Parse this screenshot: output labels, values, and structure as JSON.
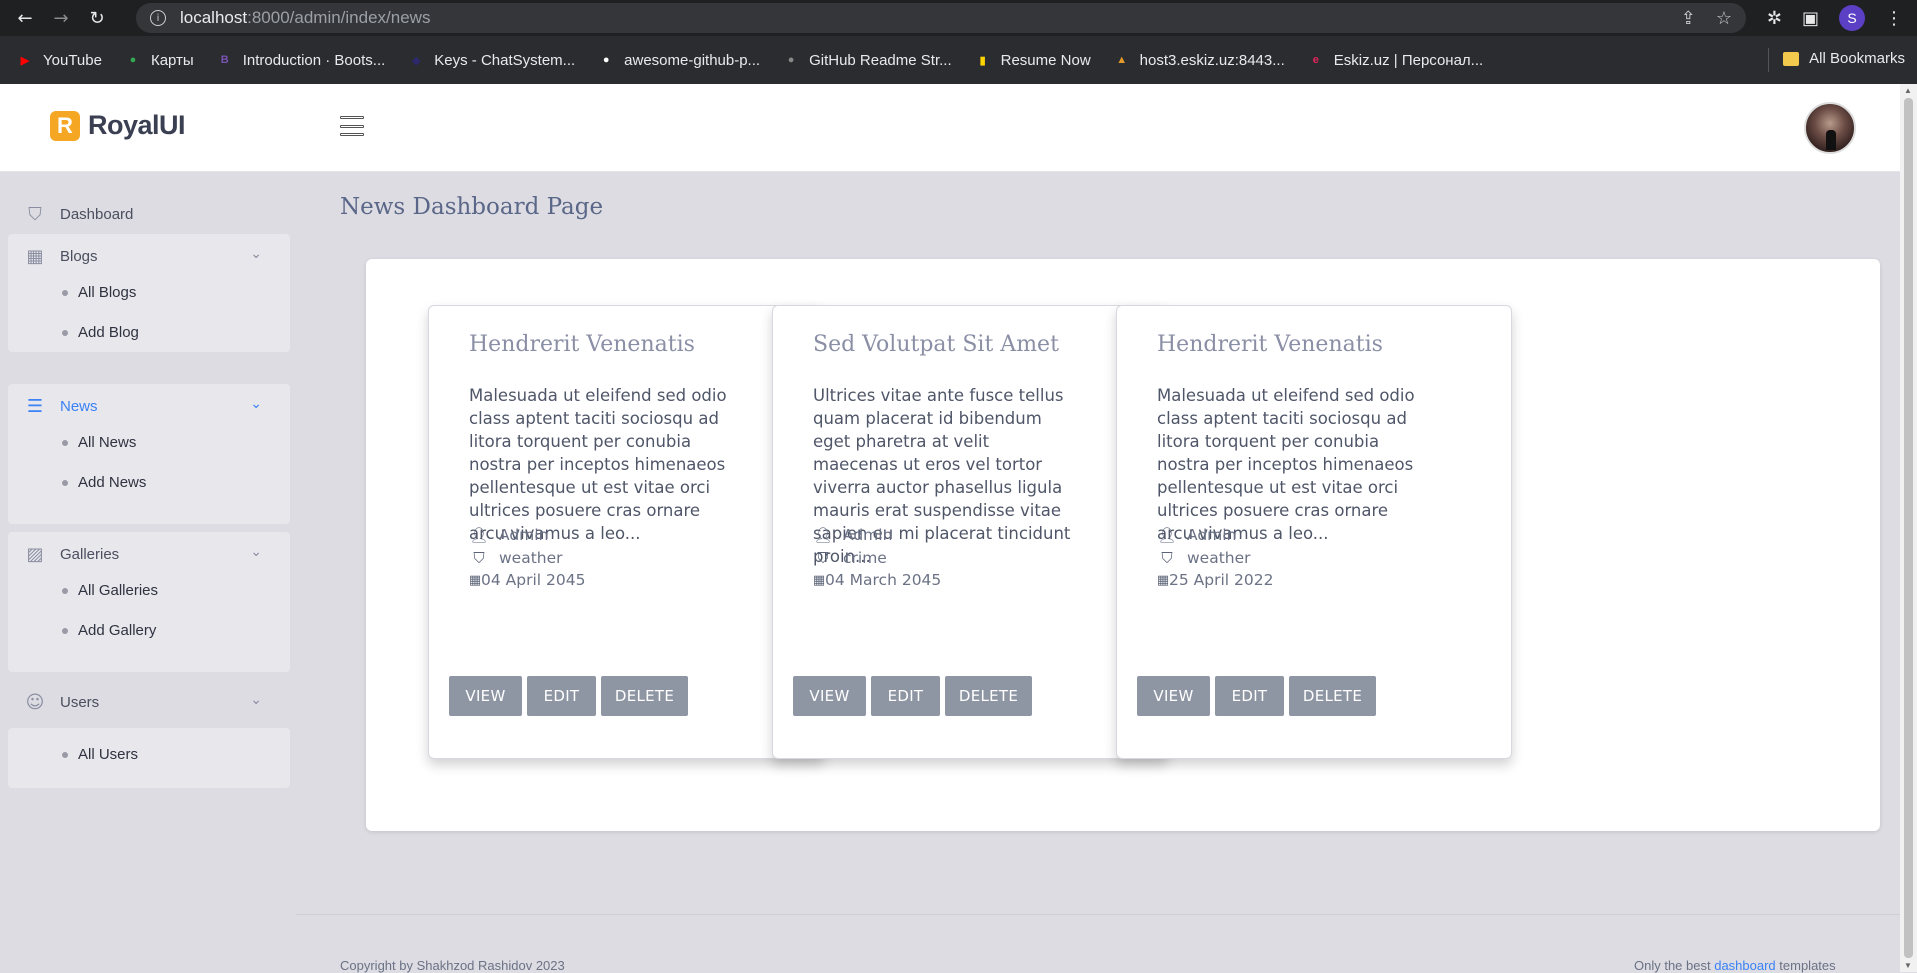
{
  "browser": {
    "url_host": "localhost",
    "url_rest": ":8000/admin/index/news",
    "profile_initial": "S",
    "bookmarks": [
      {
        "label": "YouTube",
        "color": "#ff0000",
        "glyph": "▶"
      },
      {
        "label": "Карты",
        "color": "#34a853",
        "glyph": "●"
      },
      {
        "label": "Introduction · Boots...",
        "color": "#7952b3",
        "glyph": "B"
      },
      {
        "label": "Keys - ChatSystem...",
        "color": "#2d2a6b",
        "glyph": "◆"
      },
      {
        "label": "awesome-github-p...",
        "color": "#ffffff",
        "glyph": "●"
      },
      {
        "label": "GitHub Readme Str...",
        "color": "#888888",
        "glyph": "●"
      },
      {
        "label": "Resume Now",
        "color": "#ffd400",
        "glyph": "▮"
      },
      {
        "label": "host3.eskiz.uz:8443...",
        "color": "#e59b2a",
        "glyph": "▲"
      },
      {
        "label": "Eskiz.uz | Персонал...",
        "color": "#e3245d",
        "glyph": "e"
      }
    ],
    "all_bookmarks": "All Bookmarks"
  },
  "app": {
    "logo_letter": "R",
    "brand_name": "RoyalUI"
  },
  "sidebar": {
    "dashboard": "Dashboard",
    "blogs": {
      "label": "Blogs",
      "items": [
        "All Blogs",
        "Add Blog"
      ]
    },
    "news": {
      "label": "News",
      "items": [
        "All News",
        "Add News"
      ]
    },
    "galleries": {
      "label": "Galleries",
      "items": [
        "All Galleries",
        "Add Gallery"
      ]
    },
    "users": {
      "label": "Users",
      "items": [
        "All Users"
      ]
    }
  },
  "main": {
    "page_title": "News Dashboard Page",
    "cards": [
      {
        "title": "Hendrerit Venenatis",
        "body": "Malesuada ut eleifend sed odio class aptent taciti sociosqu ad litora torquent per conubia nostra per inceptos himenaeos pellentesque ut est vitae orci ultrices posuere cras ornare arcu vivamus a leo...",
        "author": "Admin",
        "tag": "weather",
        "date": "04 April 2045"
      },
      {
        "title": "Sed Volutpat Sit Amet",
        "body": "Ultrices vitae ante fusce tellus quam placerat id bibendum eget pharetra at velit maecenas ut eros vel tortor viverra auctor phasellus ligula mauris erat suspendisse vitae sapien eu mi placerat tincidunt proin...",
        "author": "Admin",
        "tag": "crime",
        "date": "04 March 2045"
      },
      {
        "title": "Hendrerit Venenatis",
        "body": "Malesuada ut eleifend sed odio class aptent taciti sociosqu ad litora torquent per conubia nostra per inceptos himenaeos pellentesque ut est vitae orci ultrices posuere cras ornare arcu vivamus a leo...",
        "author": "Admin",
        "tag": "weather",
        "date": "25 April 2022"
      }
    ],
    "buttons": {
      "view": "VIEW",
      "edit": "EDIT",
      "delete": "DELETE"
    }
  },
  "footer": {
    "copyright": "Copyright by Shakhzod Rashidov 2023",
    "right_prefix": "Only the best ",
    "right_link": "dashboard",
    "right_suffix": " templates"
  }
}
